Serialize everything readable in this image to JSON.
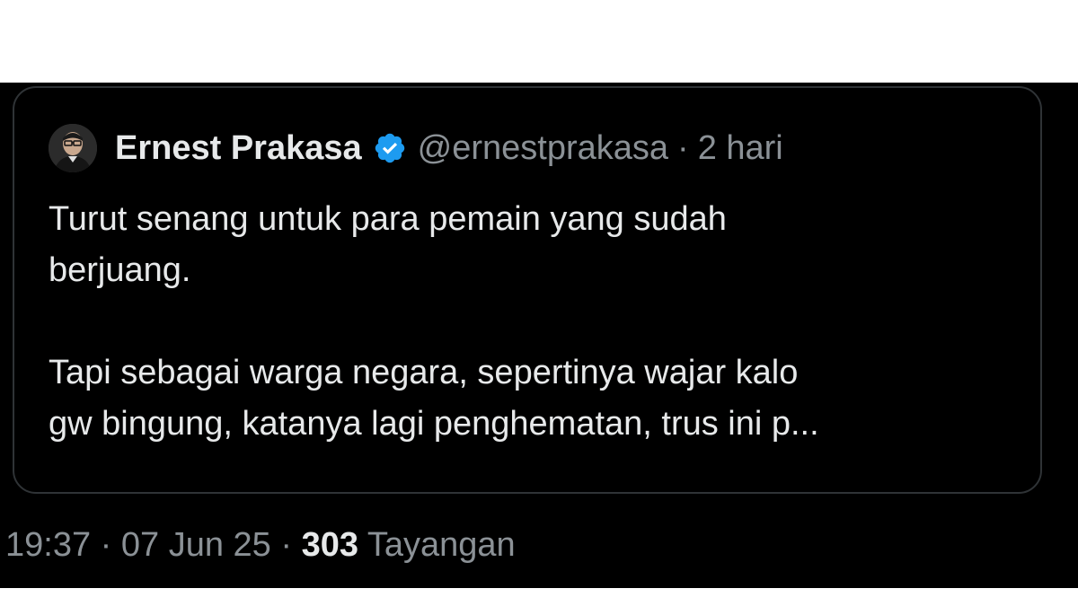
{
  "quoted_tweet": {
    "display_name": "Ernest Prakasa",
    "handle": "@ernestprakasa",
    "separator": "·",
    "time_ago": "2 hari",
    "verified": true,
    "verified_color": "#1d9bf0",
    "avatar_icon": "profile-photo",
    "body_paragraphs": [
      "Turut senang untuk para pemain yang sudah\nberjuang.",
      "Tapi sebagai warga negara, sepertinya wajar kalo\ngw bingung, katanya lagi penghematan, trus ini p..."
    ]
  },
  "meta": {
    "time": "19:37",
    "separator": "·",
    "date": "07 Jun 25",
    "views_count": "303",
    "views_label": "Tayangan"
  },
  "colors": {
    "background": "#000000",
    "primary_text": "#e7e9ea",
    "secondary_text": "#8b9196",
    "card_border": "#2f3336"
  }
}
